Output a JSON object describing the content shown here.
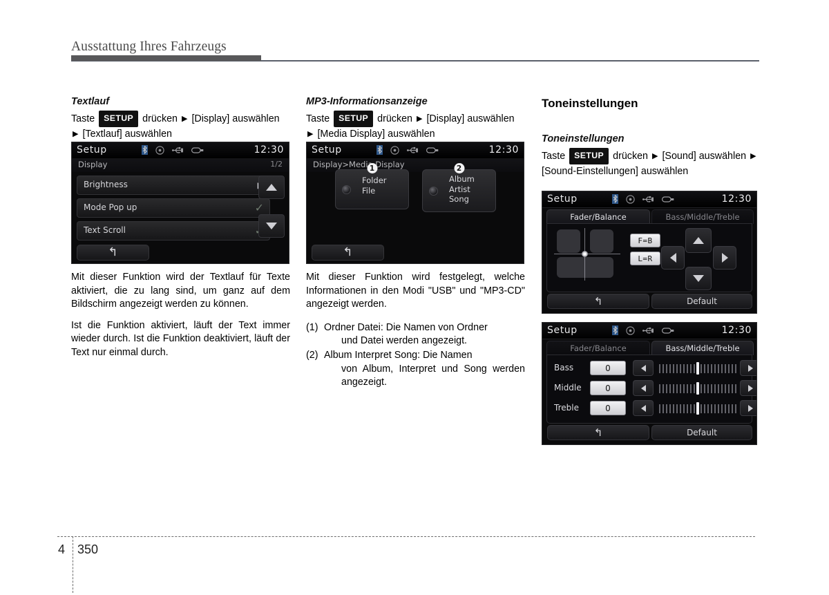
{
  "header": {
    "title": "Ausstattung Ihres Fahrzeugs"
  },
  "footer": {
    "chapter": "4",
    "page": "350"
  },
  "col1": {
    "sub_head": "Textlauf",
    "path": {
      "taste": "Taste",
      "key": "SETUP",
      "druecken": "drücken",
      "target1": "[Display]",
      "auswaehlen1": "auswählen",
      "target2": "[Textlauf]",
      "auswaehlen2": "auswählen"
    },
    "para1": "Mit dieser Funktion wird der Textlauf für Texte aktiviert, die zu lang sind, um ganz auf dem Bildschirm angezeigt werden zu können.",
    "para2": "Ist die Funktion aktiviert, läuft der Text immer wieder durch. Ist die Funktion deaktiviert, läuft der Text nur einmal durch."
  },
  "col2": {
    "sub_head": "MP3-Informationsanzeige",
    "path": {
      "taste": "Taste",
      "key": "SETUP",
      "druecken": "drücken",
      "target1": "[Display]",
      "auswaehlen1": "auswählen",
      "target2": "[Media Display]",
      "auswaehlen2": "auswählen"
    },
    "para1": "Mit dieser Funktion wird festgelegt, welche Informationen in den Modi \"USB\" und \"MP3-CD\" angezeigt werden.",
    "items": [
      {
        "num": "(1)",
        "text": "Ordner Datei: Die Namen von Ordner",
        "cont": "und Datei werden angezeigt."
      },
      {
        "num": "(2)",
        "text": "Album Interpret Song: Die Namen",
        "cont": "von Album, Interpret und Song werden angezeigt."
      }
    ]
  },
  "col3": {
    "sec_head": "Toneinstellungen",
    "sub_head": "Toneinstellungen",
    "path": {
      "taste": "Taste",
      "key": "SETUP",
      "druecken": "drücken",
      "target1": "[Sound]",
      "auswaehlen1": "auswählen",
      "target2": "[Sound-Einstellungen]",
      "auswaehlen2": "auswählen"
    }
  },
  "screen1": {
    "title": "Setup",
    "clock": "12:30",
    "breadcrumb": "Display",
    "page_indicator": "1/2",
    "rows": [
      {
        "label": "Brightness",
        "control": "chevron"
      },
      {
        "label": "Mode Pop up",
        "control": "check"
      },
      {
        "label": "Text Scroll",
        "control": "check"
      }
    ],
    "scroll_up": "▲",
    "scroll_down": "▼",
    "back": "↰"
  },
  "screen2": {
    "title": "Setup",
    "clock": "12:30",
    "breadcrumb": "Display>Media Display",
    "cards": [
      {
        "badge": "1",
        "lines": [
          "Folder",
          "File"
        ]
      },
      {
        "badge": "2",
        "lines": [
          "Album",
          "Artist",
          "Song"
        ]
      }
    ],
    "back": "↰"
  },
  "screen3": {
    "title": "Setup",
    "clock": "12:30",
    "tabs": [
      {
        "label": "Fader/Balance",
        "active": true
      },
      {
        "label": "Bass/Middle/Treble",
        "active": false
      }
    ],
    "buttons": {
      "fb": "F=B",
      "lr": "L=R"
    },
    "back": "↰",
    "default": "Default"
  },
  "screen4": {
    "title": "Setup",
    "clock": "12:30",
    "tabs": [
      {
        "label": "Fader/Balance",
        "active": false
      },
      {
        "label": "Bass/Middle/Treble",
        "active": true
      }
    ],
    "eq": [
      {
        "label": "Bass",
        "value": "0"
      },
      {
        "label": "Middle",
        "value": "0"
      },
      {
        "label": "Treble",
        "value": "0"
      }
    ],
    "back": "↰",
    "default": "Default"
  },
  "icons": {
    "bluetooth": "bluetooth-icon",
    "disc": "disc-icon",
    "usb": "usb-icon",
    "aux": "aux-icon"
  },
  "colors": {
    "rule": "#58585a",
    "screen_bg": "#0a0a0b",
    "key_bg": "#111111"
  }
}
